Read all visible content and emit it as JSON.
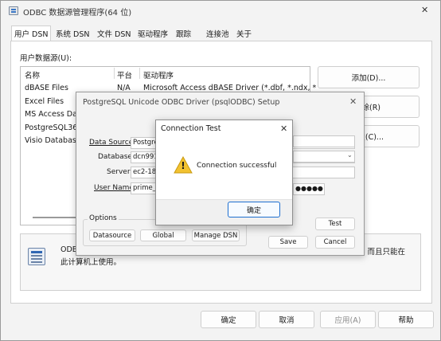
{
  "main_window": {
    "title": "ODBC 数据源管理程序(64 位)",
    "close_glyph": "✕",
    "tabs": [
      "用户 DSN",
      "系统 DSN",
      "文件 DSN",
      "驱动程序",
      "跟踪",
      "连接池",
      "关于"
    ],
    "section_label": "用户数据源(U):",
    "columns": {
      "name": "名称",
      "platform": "平台",
      "driver": "驱动程序"
    },
    "rows": [
      {
        "name": "dBASE Files",
        "platform": "N/A",
        "driver": "Microsoft Access dBASE Driver (*.dbf, *.ndx, *"
      },
      {
        "name": "Excel Files",
        "platform": "",
        "driver": ""
      },
      {
        "name": "MS Access Dat",
        "platform": "",
        "driver": ""
      },
      {
        "name": "PostgreSQL36",
        "platform": "",
        "driver": ""
      },
      {
        "name": "Visio Database",
        "platform": "",
        "driver": ""
      }
    ],
    "side_buttons": {
      "add": "添加(D)...",
      "remove": "删除(R)",
      "configure": "配置(C)..."
    },
    "info_text_line1": "ODBC",
    "info_text_right": "，而且只能在",
    "info_text_line2": "此计算机上使用。",
    "bottom_buttons": {
      "ok": "确定",
      "cancel": "取消",
      "apply": "应用(A)",
      "help": "帮助"
    }
  },
  "setup_dialog": {
    "title": "PostgreSQL Unicode ODBC Driver (psqlODBC) Setup",
    "close_glyph": "✕",
    "labels": {
      "data_source": "Data Source",
      "database": "Database",
      "server": "Server",
      "user_name": "User Name"
    },
    "values": {
      "data_source": "Postgre",
      "database": "dcn991",
      "server": "ec2-18-",
      "user_name": "prime_p"
    },
    "password_mask": "●●●●●",
    "options_label": "Options",
    "buttons": {
      "datasource": "Datasource",
      "global": "Global",
      "manage_dsn": "Manage DSN",
      "test": "Test",
      "save": "Save",
      "cancel": "Cancel"
    }
  },
  "connection_test": {
    "title": "Connection Test",
    "close_glyph": "✕",
    "message": "Connection successful",
    "warning_glyph": "!",
    "ok_label": "确定"
  }
}
